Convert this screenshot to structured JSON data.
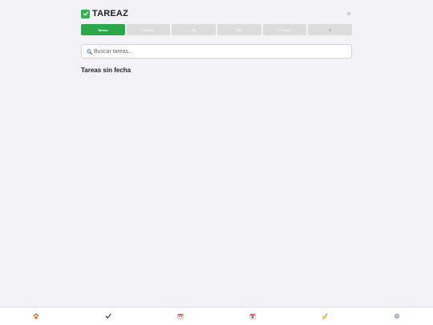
{
  "app": {
    "title": "TAREAZ"
  },
  "tabs": [
    {
      "label": "Tareas",
      "active": true
    },
    {
      "label": "Hechas",
      "active": false
    },
    {
      "label": "Mis",
      "active": false
    },
    {
      "label": "Afo",
      "active": false
    },
    {
      "label": "+ Nueva",
      "active": false
    },
    {
      "label": "⚙",
      "active": false
    }
  ],
  "search": {
    "placeholder": "Buscar tareas...",
    "value": ""
  },
  "section": {
    "title": "Tareas sin fecha"
  },
  "icons": {
    "title_check": "check-box-icon",
    "theme_toggle": "moon-icon",
    "search": "search-icon",
    "nav": [
      "home-icon",
      "checkmark-icon",
      "calendar-icon",
      "calendar-date-icon",
      "writing-hand-icon",
      "gear-icon"
    ]
  },
  "colors": {
    "accent": "#2aa84a",
    "tab_inactive": "#dcdcdc",
    "background": "#f2f2f7"
  }
}
